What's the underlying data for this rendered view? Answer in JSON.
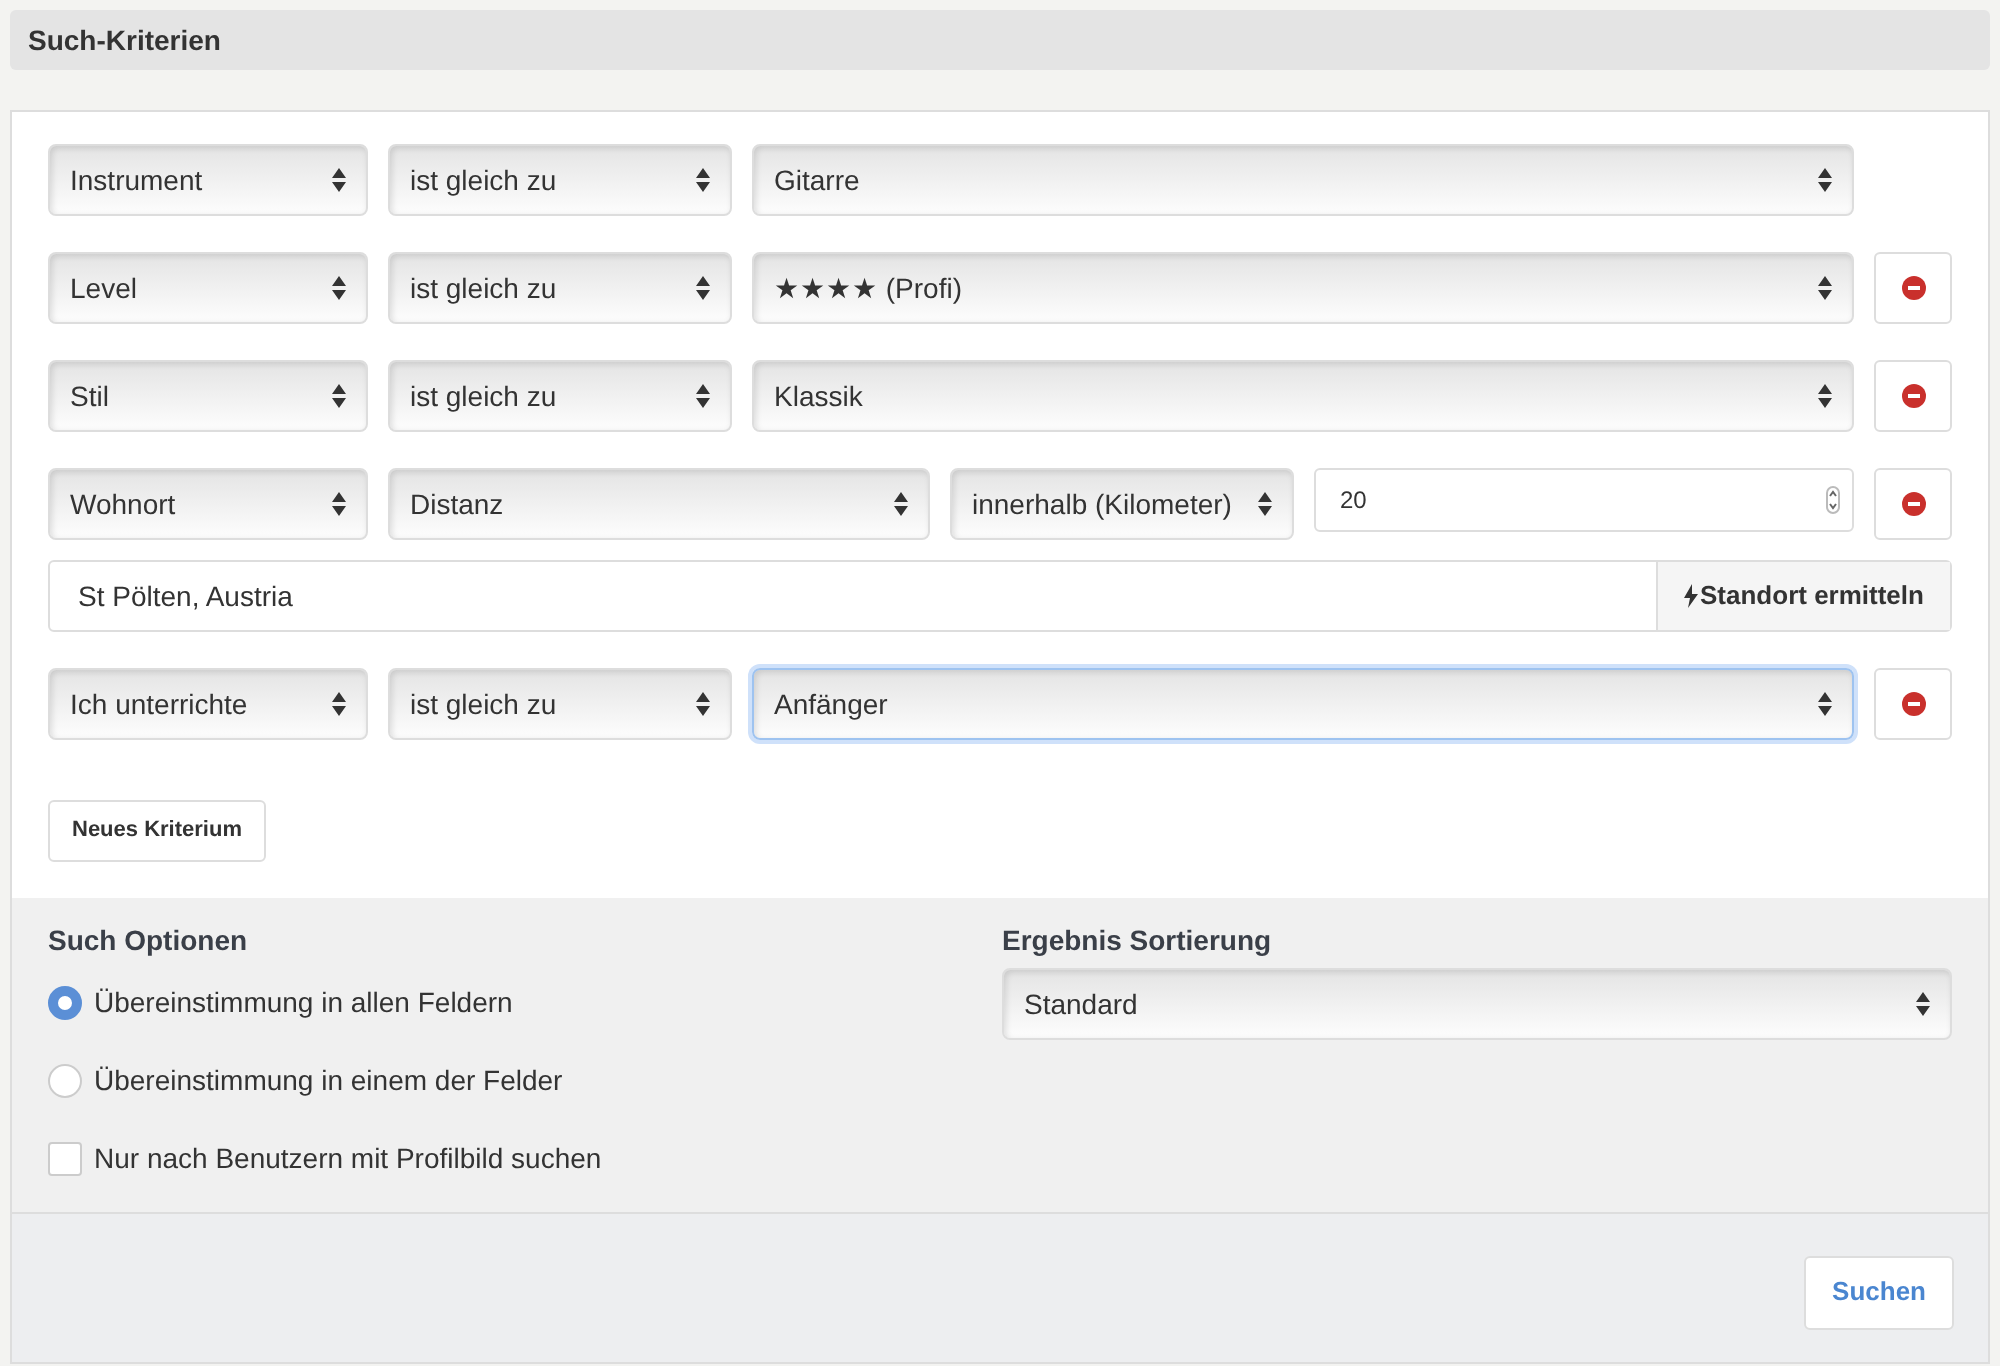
{
  "header": {
    "title": "Such-Kriterien"
  },
  "criteria": [
    {
      "kind": "select",
      "field": "Instrument",
      "operator": "ist gleich zu",
      "value": "Gitarre",
      "removable": false,
      "focused": false
    },
    {
      "kind": "select",
      "field": "Level",
      "operator": "ist gleich zu",
      "value": "★★★★ (Profi)",
      "removable": true,
      "focused": false
    },
    {
      "kind": "select",
      "field": "Stil",
      "operator": "ist gleich zu",
      "value": "Klassik",
      "removable": true,
      "focused": false
    },
    {
      "kind": "distance",
      "field": "Wohnort",
      "operator": "Distanz",
      "unit": "innerhalb (Kilometer)",
      "number": "20",
      "location": "St Pölten, Austria",
      "locate_button": "Standort ermitteln",
      "removable": true
    },
    {
      "kind": "select",
      "field": "Ich unterrichte",
      "operator": "ist gleich zu",
      "value": "Anfänger",
      "removable": true,
      "focused": true
    }
  ],
  "add_button": "Neues Kriterium",
  "search_options": {
    "title": "Such Optionen",
    "radios": [
      {
        "label": "Übereinstimmung in allen Feldern",
        "selected": true
      },
      {
        "label": "Übereinstimmung in einem der Felder",
        "selected": false
      }
    ],
    "checkbox": {
      "label": "Nur nach Benutzern mit Profilbild suchen",
      "checked": false
    }
  },
  "sorting": {
    "title": "Ergebnis Sortierung",
    "value": "Standard"
  },
  "submit_button": "Suchen"
}
